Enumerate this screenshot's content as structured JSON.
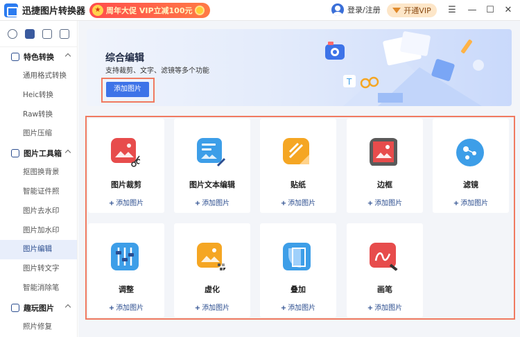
{
  "app": {
    "title": "迅捷图片转换器"
  },
  "promo": {
    "text": "周年大促 VIP立减100元"
  },
  "user": {
    "login": "登录/注册"
  },
  "vip": {
    "label": "开通VIP"
  },
  "sidebar": {
    "sections": [
      {
        "title": "特色转换",
        "items": [
          "通用格式转换",
          "Heic转换",
          "Raw转换",
          "图片压缩"
        ]
      },
      {
        "title": "图片工具箱",
        "items": [
          "抠图换背景",
          "智能证件照",
          "图片去水印",
          "图片加水印",
          "图片编辑",
          "图片转文字",
          "智能消除笔"
        ]
      },
      {
        "title": "趣玩图片",
        "items": [
          "照片修复"
        ]
      }
    ],
    "active": "图片编辑"
  },
  "banner": {
    "title": "综合编辑",
    "subtitle": "支持裁剪、文字、滤镜等多个功能",
    "button": "添加图片"
  },
  "tools": [
    {
      "name": "图片裁剪",
      "add": "添加图片",
      "icon": "crop-icon",
      "color": "#e74c4c"
    },
    {
      "name": "图片文本编辑",
      "add": "添加图片",
      "icon": "text-edit-icon",
      "color": "#3d9ee8"
    },
    {
      "name": "贴纸",
      "add": "添加图片",
      "icon": "sticker-icon",
      "color": "#f5a623"
    },
    {
      "name": "边框",
      "add": "添加图片",
      "icon": "frame-icon",
      "color": "#e74c4c"
    },
    {
      "name": "滤镜",
      "add": "添加图片",
      "icon": "filter-icon",
      "color": "#3d9ee8"
    },
    {
      "name": "调整",
      "add": "添加图片",
      "icon": "adjust-icon",
      "color": "#3d9ee8"
    },
    {
      "name": "虚化",
      "add": "添加图片",
      "icon": "blur-icon",
      "color": "#f5a623"
    },
    {
      "name": "叠加",
      "add": "添加图片",
      "icon": "overlay-icon",
      "color": "#3d9ee8"
    },
    {
      "name": "画笔",
      "add": "添加图片",
      "icon": "brush-icon",
      "color": "#e74c4c"
    }
  ]
}
